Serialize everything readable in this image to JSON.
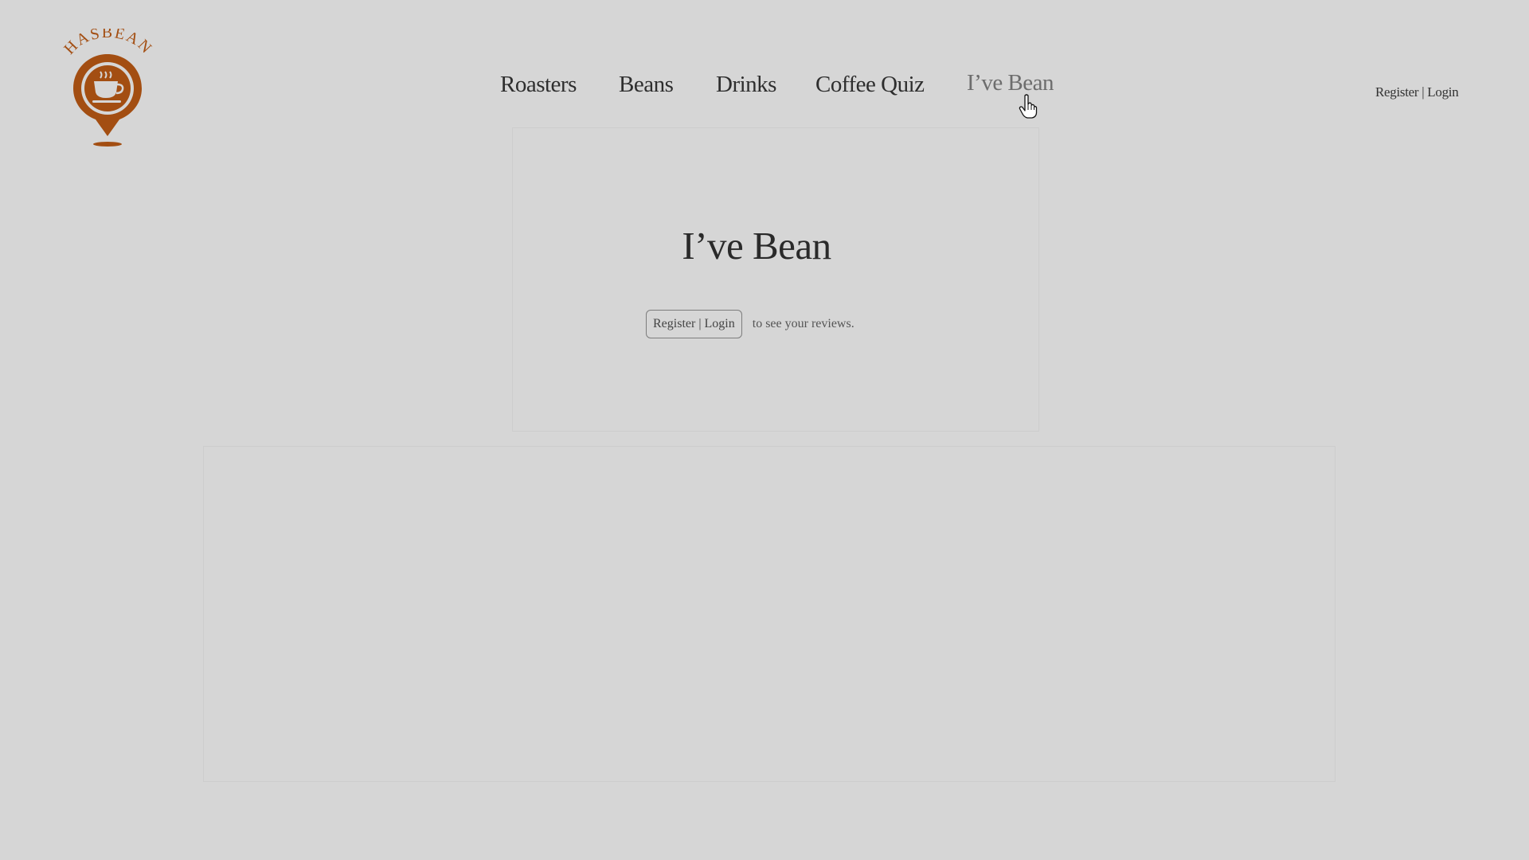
{
  "brand": {
    "logo_text": "HASBEAN",
    "logo_color": "#a34e12"
  },
  "nav": {
    "items": [
      {
        "label": "Roasters"
      },
      {
        "label": "Beans"
      },
      {
        "label": "Drinks"
      },
      {
        "label": "Coffee Quiz"
      },
      {
        "label": "I’ve Bean",
        "active": true
      }
    ]
  },
  "header": {
    "auth_register": "Register",
    "auth_separator": " | ",
    "auth_login": "Login"
  },
  "main": {
    "title": "I’ve Bean",
    "auth_button_label": "Register | Login",
    "prompt_suffix": "to see your reviews."
  },
  "icons": {
    "cursor": "hand-pointer-icon",
    "logo": "coffee-cup-pin-icon"
  }
}
